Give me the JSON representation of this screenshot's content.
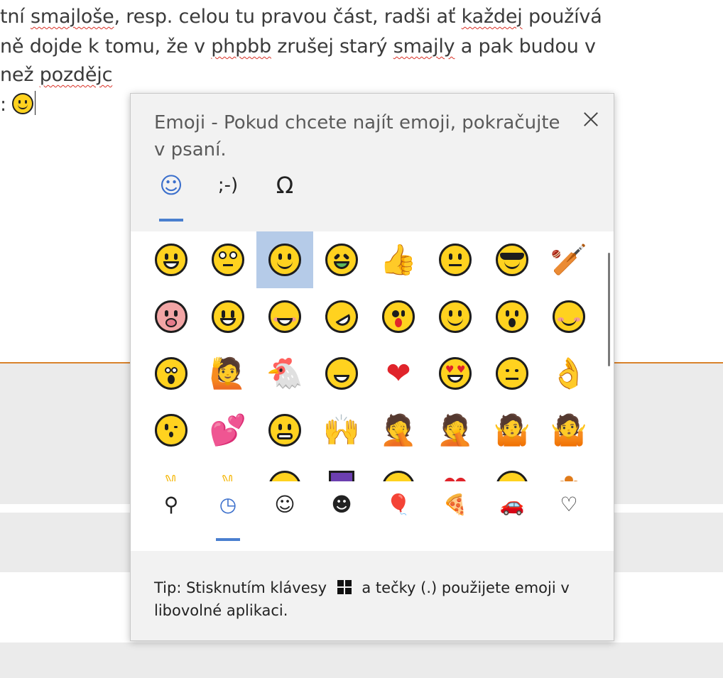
{
  "document": {
    "line1": [
      "tní ",
      "smajloše",
      ", resp. celou tu pravou část, radši ať ",
      "každej",
      " používá"
    ],
    "line2": [
      "ně dojde k tomu, že v ",
      "phpbb",
      " zrušej starý ",
      "smajly",
      " a pak budou v"
    ],
    "line3": [
      " než ",
      "pozdějc"
    ],
    "line4_prefix": ":"
  },
  "panel": {
    "title": "Emoji - Pokud chcete najít emoji, pokračujte v psaní.",
    "close_label": "×",
    "top_tabs": [
      {
        "label": "☺",
        "name": "emoji"
      },
      {
        "label": ";-)",
        "name": "kaomoji"
      },
      {
        "label": "Ω",
        "name": "symbols"
      }
    ],
    "active_top_tab": "emoji",
    "emoji_rows": [
      [
        "grinning",
        "rolling-eyes",
        "slightly-smiling",
        "nauseated",
        "thumbs-up",
        "neutral",
        "cool-sunglasses",
        "cricket"
      ],
      [
        "pig",
        "smiley",
        "blush",
        "rofl",
        "zany",
        "yum",
        "hushed",
        "smiling-blush"
      ],
      [
        "astonished",
        "raising-hand",
        "chicken",
        "joy",
        "red-heart",
        "heart-eyes",
        "unamused",
        "ok-hand"
      ],
      [
        "kissing-heart",
        "two-hearts",
        "grimacing",
        "raised-hands",
        "facepalm-woman",
        "facepalm-man",
        "shrug-woman",
        "shrug-man"
      ]
    ],
    "selected_emoji": "slightly-smiling",
    "bottom_nav": [
      {
        "name": "search",
        "label": "⚲"
      },
      {
        "name": "recent",
        "label": "◷"
      },
      {
        "name": "smileys",
        "label": "☺"
      },
      {
        "name": "people",
        "label": "☻"
      },
      {
        "name": "celebration",
        "label": "🎈"
      },
      {
        "name": "food",
        "label": "🍕"
      },
      {
        "name": "travel",
        "label": "🚗"
      },
      {
        "name": "symbols",
        "label": "♡"
      }
    ],
    "active_bottom_nav": "recent",
    "tip_before": "Tip: Stisknutím klávesy",
    "tip_after": "a tečky (.) použijete emoji v libovolné aplikaci."
  }
}
